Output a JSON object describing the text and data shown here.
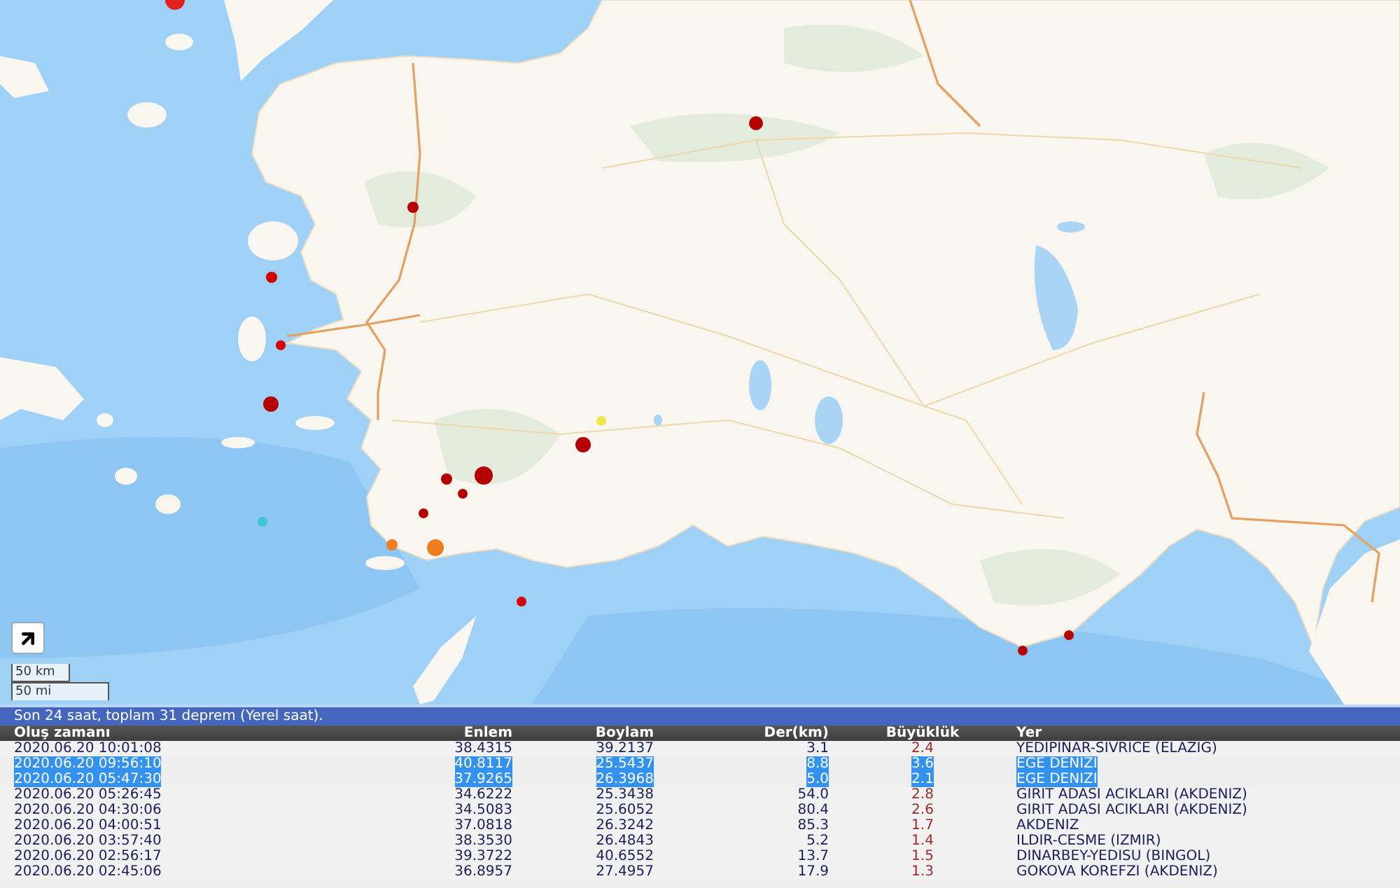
{
  "map": {
    "markers": [
      {
        "color": "#e3211c"
      },
      {
        "color": "#b40000"
      },
      {
        "color": "#b40000"
      },
      {
        "color": "#d40000"
      },
      {
        "color": "#d40000"
      },
      {
        "color": "#b40000"
      },
      {
        "color": "#b40000"
      },
      {
        "color": "#f2e24c"
      },
      {
        "color": "#b40000"
      },
      {
        "color": "#b40000"
      },
      {
        "color": "#b40000"
      },
      {
        "color": "#b40000"
      },
      {
        "color": "#3cc6d6"
      },
      {
        "color": "#f07d1e"
      },
      {
        "color": "#f07d1e"
      },
      {
        "color": "#d40000"
      },
      {
        "color": "#b40000"
      },
      {
        "color": "#b40000"
      }
    ],
    "scale": [
      "50 km",
      "50 mi"
    ]
  },
  "table": {
    "caption": "Son 24 saat, toplam 31 deprem (Yerel saat).",
    "columns": [
      "Oluş zamanı",
      "Enlem",
      "Boylam",
      "Der(km)",
      "Büyüklük",
      "Yer"
    ],
    "rows": [
      {
        "cells": [
          "2020.06.20 10:01:08",
          "38.4315",
          "39.2137",
          "3.1",
          "2.4",
          "YEDIPINAR-SIVRICE (ELAZIG)"
        ],
        "selected": false
      },
      {
        "cells": [
          "2020.06.20 09:56:10",
          "40.8117",
          "25.5437",
          "8.8",
          "3.6",
          "EGE DENIZI"
        ],
        "selected": true
      },
      {
        "cells": [
          "2020.06.20 05:47:30",
          "37.9265",
          "26.3968",
          "5.0",
          "2.1",
          "EGE DENIZI"
        ],
        "selected": true
      },
      {
        "cells": [
          "2020.06.20 05:26:45",
          "34.6222",
          "25.3438",
          "54.0",
          "2.8",
          "GIRIT ADASI ACIKLARI (AKDENIZ)"
        ],
        "selected": false
      },
      {
        "cells": [
          "2020.06.20 04:30:06",
          "34.5083",
          "25.6052",
          "80.4",
          "2.6",
          "GIRIT ADASI ACIKLARI (AKDENIZ)"
        ],
        "selected": false
      },
      {
        "cells": [
          "2020.06.20 04:00:51",
          "37.0818",
          "26.3242",
          "85.3",
          "1.7",
          "AKDENIZ"
        ],
        "selected": false
      },
      {
        "cells": [
          "2020.06.20 03:57:40",
          "38.3530",
          "26.4843",
          "5.2",
          "1.4",
          "ILDIR-CESME (IZMIR)"
        ],
        "selected": false
      },
      {
        "cells": [
          "2020.06.20 02:56:17",
          "39.3722",
          "40.6552",
          "13.7",
          "1.5",
          "DINARBEY-YEDISU (BINGOL)"
        ],
        "selected": false
      },
      {
        "cells": [
          "2020.06.20 02:45:06",
          "36.8957",
          "27.4957",
          "17.9",
          "1.3",
          "GOKOVA KOREFZI (AKDENIZ)"
        ],
        "selected": false
      }
    ]
  }
}
